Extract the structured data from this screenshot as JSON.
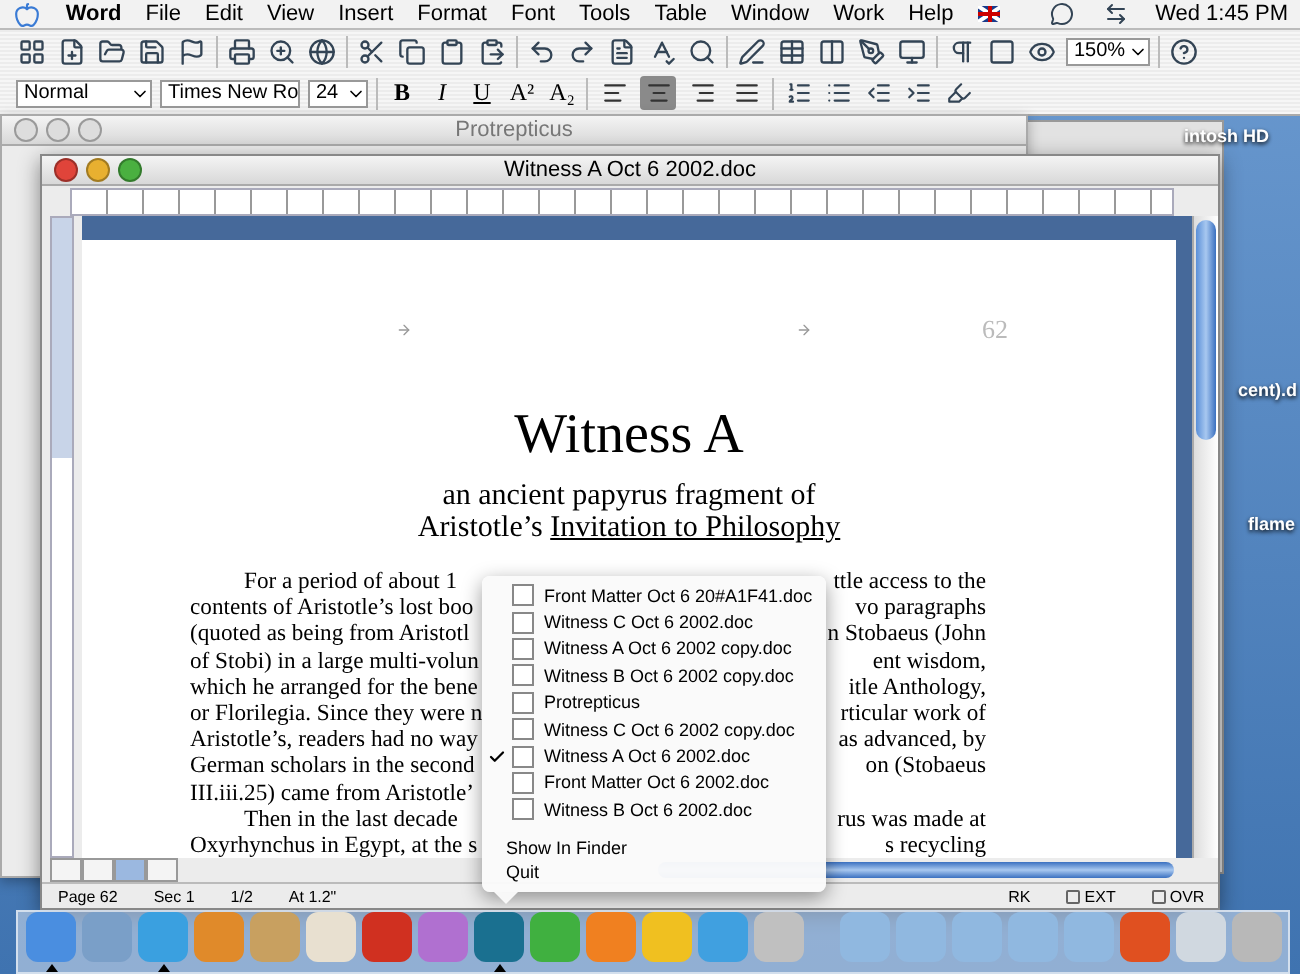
{
  "menu_bar": {
    "app": "Word",
    "items": [
      "File",
      "Edit",
      "View",
      "Insert",
      "Format",
      "Font",
      "Tools",
      "Table",
      "Window",
      "Work",
      "Help"
    ],
    "clock": "Wed 1:45 PM"
  },
  "standard_toolbar": {
    "zoom": "150%"
  },
  "formatting_toolbar": {
    "style": "Normal",
    "font": "Times New Ro",
    "size": "24",
    "text_buttons": [
      "B",
      "I",
      "U",
      "A²",
      "A₂"
    ],
    "alignment": [
      {
        "kind": "left",
        "selected": false
      },
      {
        "kind": "center",
        "selected": true
      },
      {
        "kind": "right",
        "selected": false
      },
      {
        "kind": "justify",
        "selected": false
      }
    ]
  },
  "background_window": {
    "title": "Protrepticus"
  },
  "desktop_labels": [
    "intosh HD",
    "cent).d",
    "flame"
  ],
  "document_window": {
    "title": "Witness A Oct 6 2002.doc",
    "page": {
      "header_number": "62",
      "title": "Witness A",
      "subtitle": "an ancient papyrus fragment of",
      "subtitle_prefix": "Aristotle’s ",
      "subtitle_work": "Invitation to Philosophy",
      "lines": [
        {
          "left": "For a period of about 1",
          "right": "ttle access to the",
          "indent": true
        },
        {
          "left": "contents of Aristotle’s lost boo",
          "right": "vo paragraphs",
          "indent": false
        },
        {
          "left": "(quoted as being from Aristotl",
          "right": "n Stobaeus (John",
          "indent": false
        },
        {
          "left": "of Stobi) in a large multi-volun",
          "right": "ent wisdom,",
          "indent": false
        },
        {
          "left": "which he arranged for the bene",
          "right": "itle Anthology,",
          "indent": false
        },
        {
          "left": "or Florilegia. Since they were n",
          "right": "rticular work of",
          "indent": false
        },
        {
          "left": "Aristotle’s, readers had no way",
          "right": "as advanced, by",
          "indent": false
        },
        {
          "left": "German scholars in the second",
          "right": "on (Stobaeus",
          "indent": false
        },
        {
          "left": "III.iii.25) came from Aristotle’",
          "indent": false
        },
        {
          "left": "Then in the last decade",
          "right": "rus was made at",
          "indent": true
        },
        {
          "left": "Oxyrhynchus in Egypt, at the s",
          "right": "s recycling",
          "indent": false
        }
      ]
    },
    "view_buttons": [
      {
        "selected": false
      },
      {
        "selected": false
      },
      {
        "selected": true
      },
      {
        "selected": false
      }
    ],
    "status_left": [
      "Page 62",
      "Sec 1",
      "1/2",
      "At 1.2\""
    ],
    "status_right": [
      {
        "label": "RK",
        "boxed": false
      },
      {
        "label": "EXT",
        "boxed": true
      },
      {
        "label": "OVR",
        "boxed": true
      }
    ]
  },
  "dock_menu": {
    "windows": [
      {
        "label": "Front Matter Oct 6 20#A1F41.doc",
        "selected": false
      },
      {
        "label": "Witness C Oct 6 2002.doc",
        "selected": false
      },
      {
        "label": "Witness A Oct 6 2002 copy.doc",
        "selected": false
      },
      {
        "label": "Witness B Oct 6 2002 copy.doc",
        "selected": false
      },
      {
        "label": "Protrepticus",
        "selected": false
      },
      {
        "label": "Witness C Oct 6 2002 copy.doc",
        "selected": false
      },
      {
        "label": "Witness A Oct 6 2002.doc",
        "selected": true
      },
      {
        "label": "Front Matter Oct 6 2002.doc",
        "selected": false
      },
      {
        "label": "Witness B Oct 6 2002.doc",
        "selected": false
      }
    ],
    "actions": [
      "Show In Finder",
      "Quit"
    ]
  },
  "dock": {
    "items": [
      {
        "running": true
      },
      {
        "running": false
      },
      {
        "running": true
      },
      {
        "running": false
      },
      {
        "running": false
      },
      {
        "running": false
      },
      {
        "running": false
      },
      {
        "running": false
      },
      {
        "running": true
      },
      {
        "running": false
      },
      {
        "running": false
      },
      {
        "running": false
      },
      {
        "running": false
      },
      {
        "running": false
      },
      {
        "running": false
      },
      {
        "running": false
      },
      {
        "running": false
      },
      {
        "running": false
      },
      {
        "running": false
      },
      {
        "running": false
      },
      {
        "running": false
      },
      {
        "running": false
      }
    ]
  }
}
